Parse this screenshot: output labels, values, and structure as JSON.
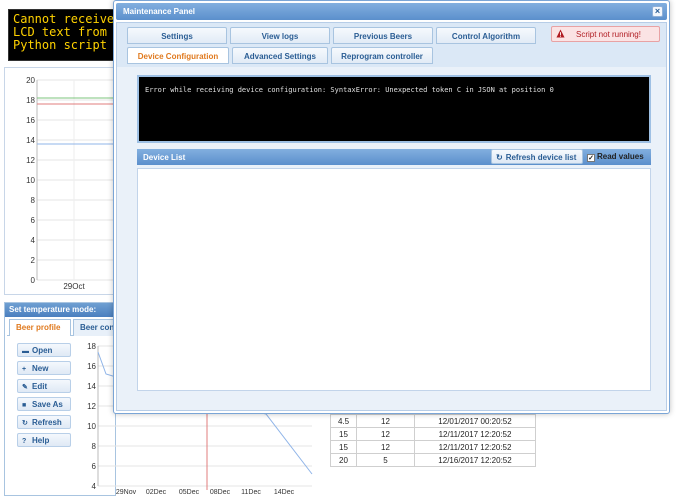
{
  "lcd": {
    "lines": [
      "Cannot receive",
      "LCD text from",
      "Python script"
    ]
  },
  "top_chart": {
    "y_ticks": [
      "20",
      "18",
      "16",
      "14",
      "12",
      "10",
      "8",
      "6",
      "4",
      "2",
      "0"
    ],
    "x_label": "29Oct"
  },
  "mode_panel": {
    "title": "Set temperature mode:",
    "tabs": [
      "Beer profile",
      "Beer const"
    ],
    "buttons": [
      "Open",
      "New",
      "Edit",
      "Save As",
      "Refresh",
      "Help"
    ]
  },
  "bottom_chart": {
    "y_ticks": [
      "18",
      "16",
      "14",
      "12",
      "10",
      "8",
      "6",
      "4"
    ],
    "x_ticks": [
      "29Nov",
      "02Dec",
      "05Dec",
      "08Dec",
      "11Dec",
      "14Dec"
    ]
  },
  "profile_table": [
    [
      "4.5",
      "12",
      "12/01/2017 00:20:52"
    ],
    [
      "15",
      "12",
      "12/11/2017 12:20:52"
    ],
    [
      "15",
      "12",
      "12/11/2017 12:20:52"
    ],
    [
      "20",
      "5",
      "12/16/2017 12:20:52"
    ]
  ],
  "dialog": {
    "title": "Maintenance Panel",
    "close_glyph": "×",
    "tabs_row1": [
      "Settings",
      "View logs",
      "Previous Beers",
      "Control Algorithm"
    ],
    "tabs_row2": [
      "Device Configuration",
      "Advanced Settings",
      "Reprogram controller"
    ],
    "alert": "Script not running!",
    "console_text": "Error while receiving device configuration: SyntaxError: Unexpected token C in JSON at position 0",
    "device_list_title": "Device List",
    "refresh_button": "Refresh device list",
    "read_values_label": "Read values",
    "read_values_checked": true
  },
  "colors": {
    "accent": "#5b8fcc",
    "active_tab": "#e07a1f",
    "alert": "#b01c22",
    "lcd_text": "#ffd200"
  }
}
